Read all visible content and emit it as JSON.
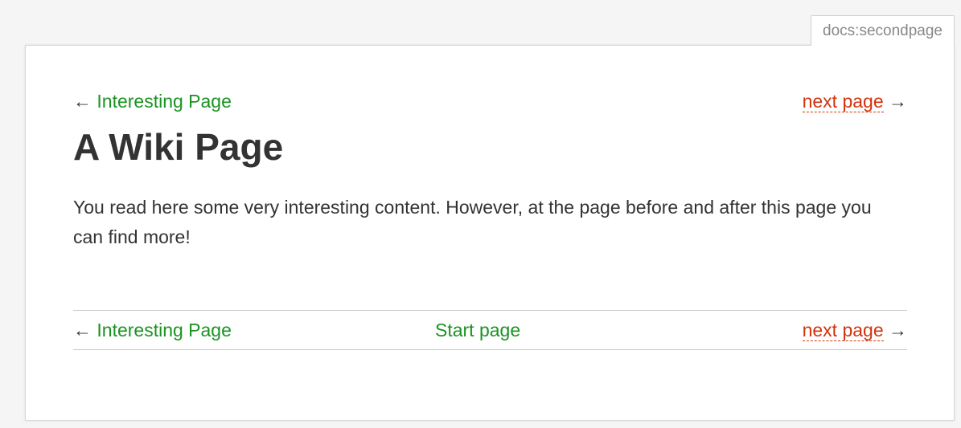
{
  "page_id": "docs:secondpage",
  "nav_top": {
    "prev_arrow": "←",
    "prev_label": "Interesting Page",
    "next_label": "next page",
    "next_arrow": "→"
  },
  "title": "A Wiki Page",
  "body_text": "You read here some very interesting content. However, at the page before and after this page you can find more!",
  "nav_bottom": {
    "prev_arrow": "←",
    "prev_label": "Interesting Page",
    "start_label": "Start page",
    "next_label": "next page",
    "next_arrow": "→"
  },
  "colors": {
    "existing_link": "#1a9322",
    "missing_link": "#d2340e",
    "text": "#333333",
    "background": "#f5f5f5",
    "page": "#ffffff"
  }
}
